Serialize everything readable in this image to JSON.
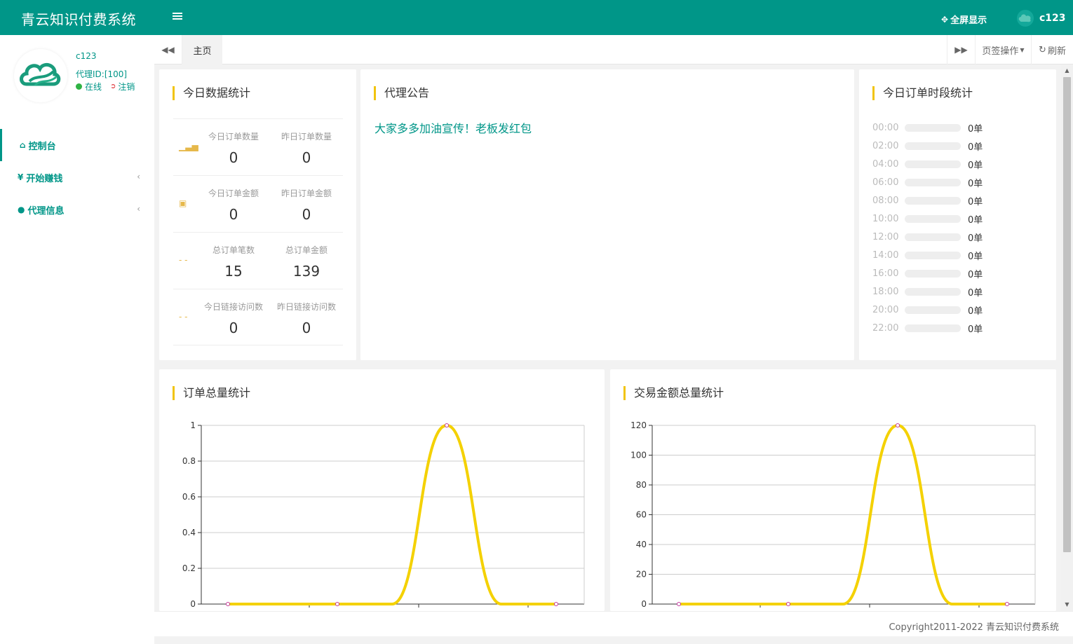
{
  "header": {
    "brand": "青云知识付费系统",
    "fullscreen_label": "全屏显示",
    "username": "c123"
  },
  "sidebar": {
    "user": {
      "name": "c123",
      "agent_id": "代理ID:[100]",
      "status": "在线",
      "logout": "注销"
    },
    "items": [
      {
        "icon": "home-icon",
        "label": "控制台",
        "active": true
      },
      {
        "icon": "yen-icon",
        "label": "开始赚钱",
        "active": false
      },
      {
        "icon": "user-icon",
        "label": "代理信息",
        "active": false
      }
    ]
  },
  "tabs": {
    "home": "主页",
    "page_ops": "页签操作",
    "refresh": "刷新"
  },
  "today_stats": {
    "title": "今日数据统计",
    "rows": [
      {
        "icon": "bar-chart-icon",
        "cells": [
          {
            "label": "今日订单数量",
            "value": "0"
          },
          {
            "label": "昨日订单数量",
            "value": "0"
          }
        ]
      },
      {
        "icon": "box-icon",
        "cells": [
          {
            "label": "今日订单金额",
            "value": "0"
          },
          {
            "label": "昨日订单金额",
            "value": "0"
          }
        ]
      },
      {
        "icon": "dash-icon",
        "cells": [
          {
            "label": "总订单笔数",
            "value": "15"
          },
          {
            "label": "总订单金额",
            "value": "139"
          }
        ]
      },
      {
        "icon": "dash-icon",
        "cells": [
          {
            "label": "今日链接访问数",
            "value": "0"
          },
          {
            "label": "昨日链接访问数",
            "value": "0"
          }
        ]
      }
    ]
  },
  "notice": {
    "title": "代理公告",
    "text": "大家多多加油宣传！老板发红包"
  },
  "timeslots": {
    "title": "今日订单时段统计",
    "slots": [
      {
        "time": "00:00",
        "count": "0单"
      },
      {
        "time": "02:00",
        "count": "0单"
      },
      {
        "time": "04:00",
        "count": "0单"
      },
      {
        "time": "06:00",
        "count": "0单"
      },
      {
        "time": "08:00",
        "count": "0单"
      },
      {
        "time": "10:00",
        "count": "0单"
      },
      {
        "time": "12:00",
        "count": "0单"
      },
      {
        "time": "14:00",
        "count": "0单"
      },
      {
        "time": "16:00",
        "count": "0单"
      },
      {
        "time": "18:00",
        "count": "0单"
      },
      {
        "time": "20:00",
        "count": "0单"
      },
      {
        "time": "22:00",
        "count": "0单"
      }
    ]
  },
  "chart_data": [
    {
      "type": "line",
      "title": "订单总量统计",
      "x": [
        0,
        1,
        2,
        3,
        4,
        5,
        6
      ],
      "series": [
        {
          "values": [
            0,
            0,
            0,
            0,
            1,
            0,
            0
          ]
        }
      ],
      "ylim": [
        0,
        1
      ],
      "yticks": [
        "0",
        "0.2",
        "0.4",
        "0.6",
        "0.8",
        "1"
      ],
      "grid": true,
      "color": "#f4d100",
      "point_color": "#c5399d"
    },
    {
      "type": "line",
      "title": "交易金额总量统计",
      "x": [
        0,
        1,
        2,
        3,
        4,
        5,
        6
      ],
      "series": [
        {
          "values": [
            0,
            0,
            0,
            0,
            120,
            0,
            0
          ]
        }
      ],
      "ylim": [
        0,
        120
      ],
      "yticks": [
        "0",
        "20",
        "40",
        "60",
        "80",
        "100",
        "120"
      ],
      "grid": true,
      "color": "#f4d100",
      "point_color": "#c5399d"
    }
  ],
  "footer": {
    "copyright": "Copyright2011-2022 青云知识付费系统"
  },
  "colors": {
    "primary": "#009688",
    "accent": "#f1c40f",
    "online": "#2fb344"
  }
}
